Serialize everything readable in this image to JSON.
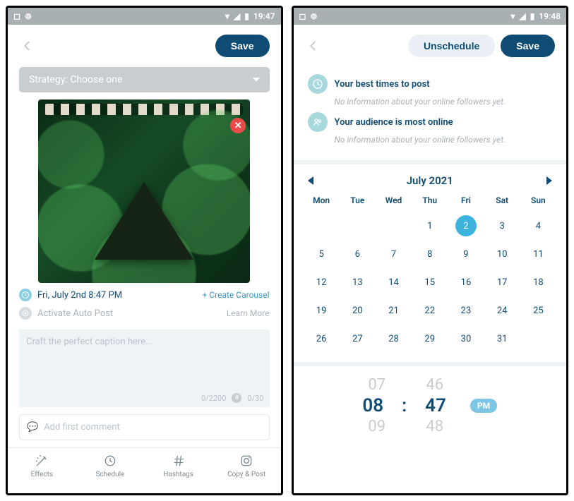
{
  "left": {
    "status_time": "19:47",
    "save_label": "Save",
    "strategy_label": "Strategy: Choose one",
    "schedule_time": "Fri, July 2nd 8:47 PM",
    "create_carousel": "+ Create Carousel",
    "auto_post": "Activate Auto Post",
    "learn_more": "Learn More",
    "caption_placeholder": "Craft the perfect caption here...",
    "char_count": "0/2200",
    "hash_count": "0/30",
    "first_comment": "Add first comment",
    "nav": {
      "effects": "Effects",
      "schedule": "Schedule",
      "hashtags": "Hashtags",
      "copy": "Copy & Post"
    }
  },
  "right": {
    "status_time": "19:48",
    "unschedule_label": "Unschedule",
    "save_label": "Save",
    "best_times_title": "Your best times to post",
    "best_times_sub": "No information about your online followers yet.",
    "audience_title": "Your audience is most online",
    "audience_sub": "No information about your online followers yet.",
    "month_label": "July 2021",
    "dow": [
      "Mon",
      "Tue",
      "Wed",
      "Thu",
      "Fri",
      "Sat",
      "Sun"
    ],
    "days_row1": [
      "",
      "",
      "",
      "1",
      "2",
      "3",
      "4"
    ],
    "days_row2": [
      "5",
      "6",
      "7",
      "8",
      "9",
      "10",
      "11"
    ],
    "days_row3": [
      "12",
      "13",
      "14",
      "15",
      "16",
      "17",
      "18"
    ],
    "days_row4": [
      "19",
      "20",
      "21",
      "22",
      "23",
      "24",
      "25"
    ],
    "days_row5": [
      "26",
      "27",
      "28",
      "29",
      "30",
      "31",
      ""
    ],
    "selected_day": "2",
    "time_above_h": "07",
    "time_above_m": "46",
    "time_h": "08",
    "time_m": "47",
    "time_below_h": "09",
    "time_below_m": "48",
    "ampm": "PM"
  }
}
